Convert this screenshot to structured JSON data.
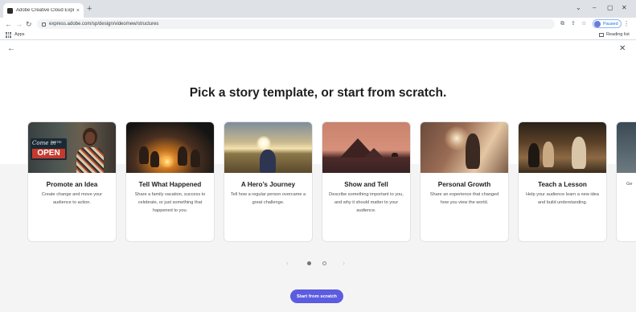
{
  "browser": {
    "tab_title": "Adobe Creative Cloud Express",
    "tab_close": "×",
    "new_tab": "+",
    "window_controls": [
      "⌄",
      "–",
      "▢",
      "✕"
    ],
    "url": "express.adobe.com/sp/design/video/new/structures",
    "profile_label": "Paused",
    "bookmarks": {
      "apps_label": "Apps",
      "reading_list_label": "Reading list"
    }
  },
  "page": {
    "heading": "Pick a story template, or start from scratch.",
    "cards": [
      {
        "title": "Promote an Idea",
        "description": "Create change and move your audience to action."
      },
      {
        "title": "Tell What Happened",
        "description": "Share a family vacation, success to celebrate, or just something that happened to you."
      },
      {
        "title": "A Hero’s Journey",
        "description": "Tell how a regular person overcame a great challenge."
      },
      {
        "title": "Show and Tell",
        "description": "Describe something important to you, and why it should matter to your audience."
      },
      {
        "title": "Personal Growth",
        "description": "Share an experience that changed how you view the world."
      },
      {
        "title": "Teach a Lesson",
        "description": "Help your audience learn a new idea and build understanding."
      },
      {
        "title": "",
        "description": "Ge"
      }
    ],
    "promote_sign": {
      "line1": "Come in",
      "line2": "WE'RE",
      "line3": "OPEN"
    },
    "start_button": "Start from scratch",
    "carousel": {
      "pages": 2,
      "active_page": 1
    }
  },
  "colors": {
    "accent": "#5c5ce0",
    "tabstrip": "#dee1e6",
    "page_lower_band": "#f4f4f4"
  },
  "icons": {
    "back": "arrow-left-icon",
    "close": "close-icon",
    "reload": "reload-icon",
    "lock": "lock-icon",
    "star": "star-icon"
  }
}
